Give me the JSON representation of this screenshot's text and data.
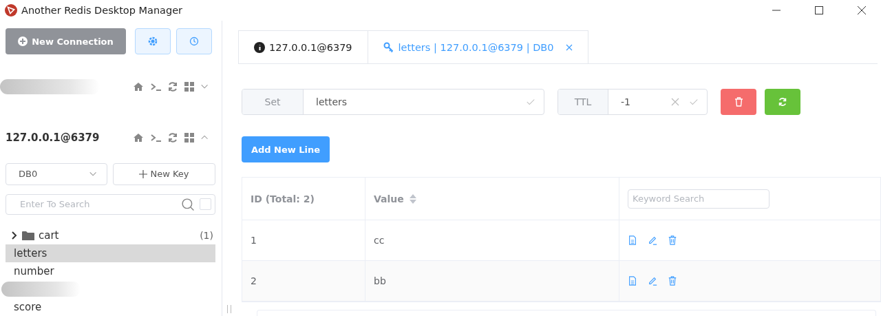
{
  "window": {
    "title": "Another Redis Desktop Manager"
  },
  "sidebar": {
    "new_connection": "New Connection",
    "connections": [
      {
        "kind": "redacted",
        "expanded": false
      },
      {
        "kind": "named",
        "name": "127.0.0.1@6379",
        "expanded": true
      }
    ],
    "db_select": {
      "value": "DB0"
    },
    "new_key": "New Key",
    "search": {
      "placeholder": "Enter To Search",
      "checked": false
    },
    "keys": [
      {
        "kind": "folder",
        "name": "cart",
        "count": "(1)",
        "expanded": false,
        "selected": false
      },
      {
        "kind": "key",
        "name": "letters",
        "selected": true
      },
      {
        "kind": "key",
        "name": "number",
        "selected": false
      },
      {
        "kind": "redacted",
        "selected": false
      },
      {
        "kind": "key",
        "name": "score",
        "selected": false
      }
    ]
  },
  "tabs": [
    {
      "kind": "info",
      "label": "127.0.0.1@6379",
      "selected": false,
      "closable": false
    },
    {
      "kind": "key",
      "label": "letters | 127.0.0.1@6379 | DB0",
      "selected": true,
      "closable": true
    }
  ],
  "key_bar": {
    "type": "Set",
    "name": "letters",
    "ttl_label": "TTL",
    "ttl": "-1"
  },
  "add_line": "Add New Line",
  "table": {
    "columns": [
      "ID (Total: 2)",
      "Value"
    ],
    "search_placeholder": "Keyword Search",
    "rows": [
      {
        "id": "1",
        "value": "cc"
      },
      {
        "id": "2",
        "value": "bb"
      }
    ]
  }
}
